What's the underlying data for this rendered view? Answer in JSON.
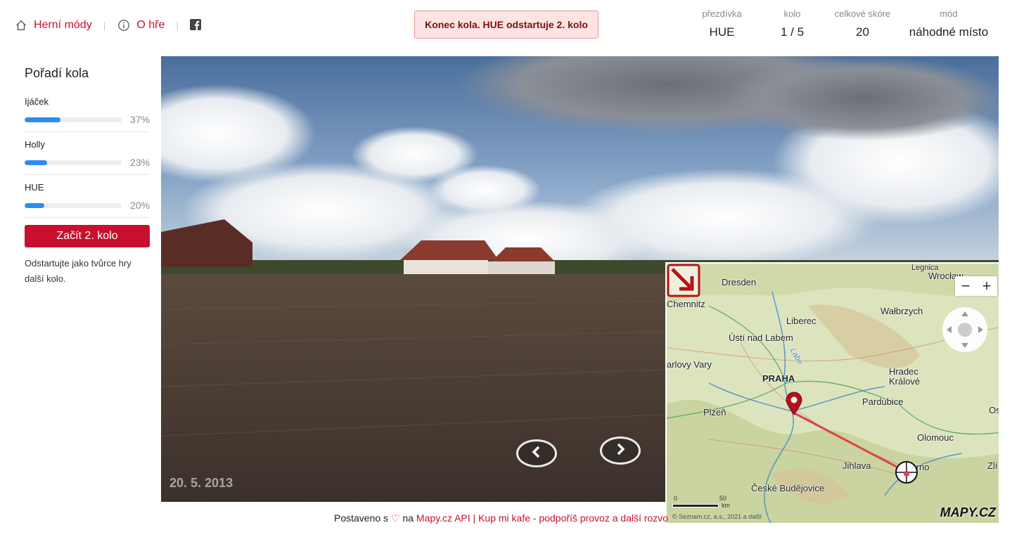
{
  "nav": {
    "game_modes": "Herní módy",
    "about": "O hře",
    "separator": "|"
  },
  "status": "Konec kola. HUE odstartuje 2. kolo",
  "stats": {
    "nick_label": "přezdívka",
    "nick_value": "HUE",
    "round_label": "kolo",
    "round_value": "1 / 5",
    "score_label": "celkové skóre",
    "score_value": "20",
    "mode_label": "mód",
    "mode_value": "náhodné místo"
  },
  "sidebar": {
    "title": "Pořadí kola",
    "players": [
      {
        "name": "Ijáček",
        "percent": "37%",
        "fill": 0.37
      },
      {
        "name": "Holly",
        "percent": "23%",
        "fill": 0.23
      },
      {
        "name": "HUE",
        "percent": "20%",
        "fill": 0.2
      }
    ],
    "start_button": "Začít 2. kolo",
    "hint": "Odstartujte jako tvůrce hry další kolo."
  },
  "panorama": {
    "date": "20. 5. 2013"
  },
  "map": {
    "labels": {
      "legnica": "Legnica",
      "wroclaw": "Wrocław",
      "dresden": "Dresden",
      "chemnitz": "Chemnitz",
      "walbrzych": "Wałbrzych",
      "liberec": "Liberec",
      "usti": "Ústí nad Labem",
      "karlovy": "arlovy Vary",
      "hradec": "Hradec",
      "kralove": "Králové",
      "praha": "PRAHA",
      "pardubice": "Pardubice",
      "plzen": "Plzeň",
      "os": "Os",
      "olomouc": "Olomouc",
      "jihlava": "Jihlava",
      "brno": "Brno",
      "zli": "Zlí",
      "budejovice": "České Budějovice",
      "labe": "Labe"
    },
    "scale_0": "0",
    "scale_50": "50",
    "scale_unit": "km",
    "attribution": "© Seznam.cz, a.s., 2021 a další",
    "logo": "MAPY.CZ",
    "zoom_out": "−",
    "zoom_in": "+"
  },
  "footer": {
    "built_with": "Postaveno s",
    "heart": "♡",
    "on": "na",
    "api_link": "Mapy.cz API",
    "sep": "|",
    "coffee_link": "Kup mi kafe - podpoříš provoz a další rozvo"
  },
  "colors": {
    "accent": "#c8102e",
    "bar": "#2d8cf0",
    "alert_bg": "#fde3e3"
  }
}
